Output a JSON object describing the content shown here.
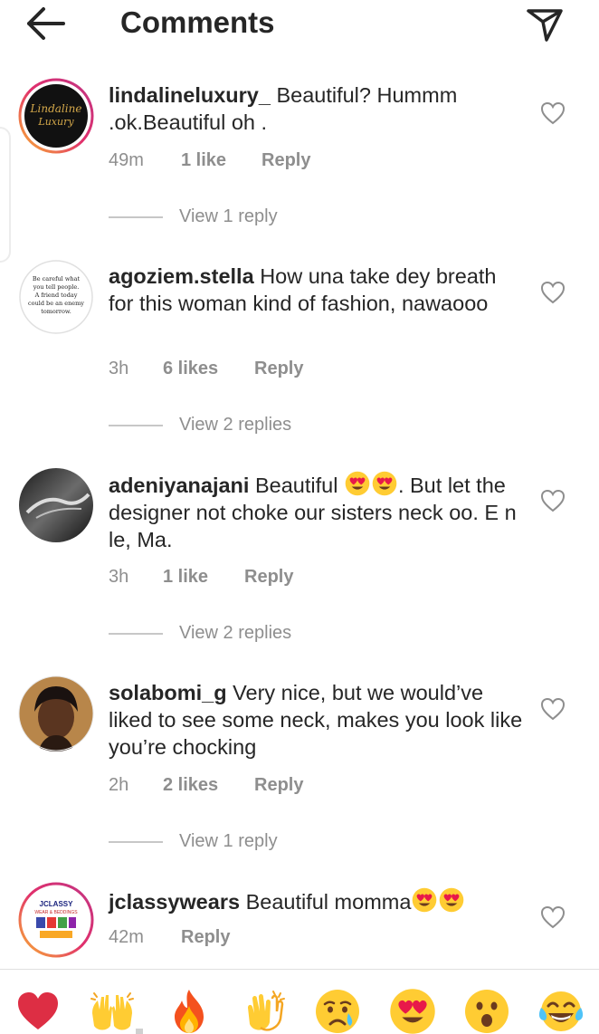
{
  "header": {
    "title": "Comments",
    "back_icon": "arrow-left-icon",
    "send_icon": "paper-plane-icon"
  },
  "comments": [
    {
      "username": "lindalineluxury_",
      "text": "Beautiful? Hummm .ok.Beautiful oh .",
      "time": "49m",
      "likes": "1 like",
      "reply": "Reply",
      "view_replies": "View 1 reply",
      "avatar_text": [
        "Lindaline",
        "Luxury"
      ]
    },
    {
      "username": "agoziem.stella",
      "text": "How una take dey breath for this woman kind of fashion, nawaooo",
      "time": "3h",
      "likes": "6 likes",
      "reply": "Reply",
      "view_replies": "View 2 replies",
      "avatar_text": [
        "Be careful what",
        "you tell people.",
        "A friend today",
        "could be an enemy",
        "tomorrow."
      ]
    },
    {
      "username": "adeniyanajani",
      "text_before_emoji": "Beautiful",
      "text_after_emoji": ". But let the designer not choke our sisters neck oo. E n le, Ma.",
      "time": "3h",
      "likes": "1 like",
      "reply": "Reply",
      "view_replies": "View 2 replies"
    },
    {
      "username": "solabomi_g",
      "text": "Very nice, but we would’ve liked to see some neck, makes you look like you’re chocking",
      "time": "2h",
      "likes": "2 likes",
      "reply": "Reply",
      "view_replies": "View 1 reply"
    },
    {
      "username": "jclassywears",
      "text": "Beautiful momma",
      "time": "42m",
      "reply": "Reply",
      "avatar_text": [
        "JCLASSY",
        "WEAR & BEDDINGS"
      ]
    }
  ],
  "quick_emojis": [
    "red-heart",
    "raising-hands",
    "fire",
    "clapping-hands",
    "crying-face",
    "heart-eyes-face",
    "surprised-face",
    "tears-of-joy-face"
  ],
  "colors": {
    "text": "#262626",
    "secondary": "#8e8e8e",
    "heart_red": "#e0245e"
  }
}
